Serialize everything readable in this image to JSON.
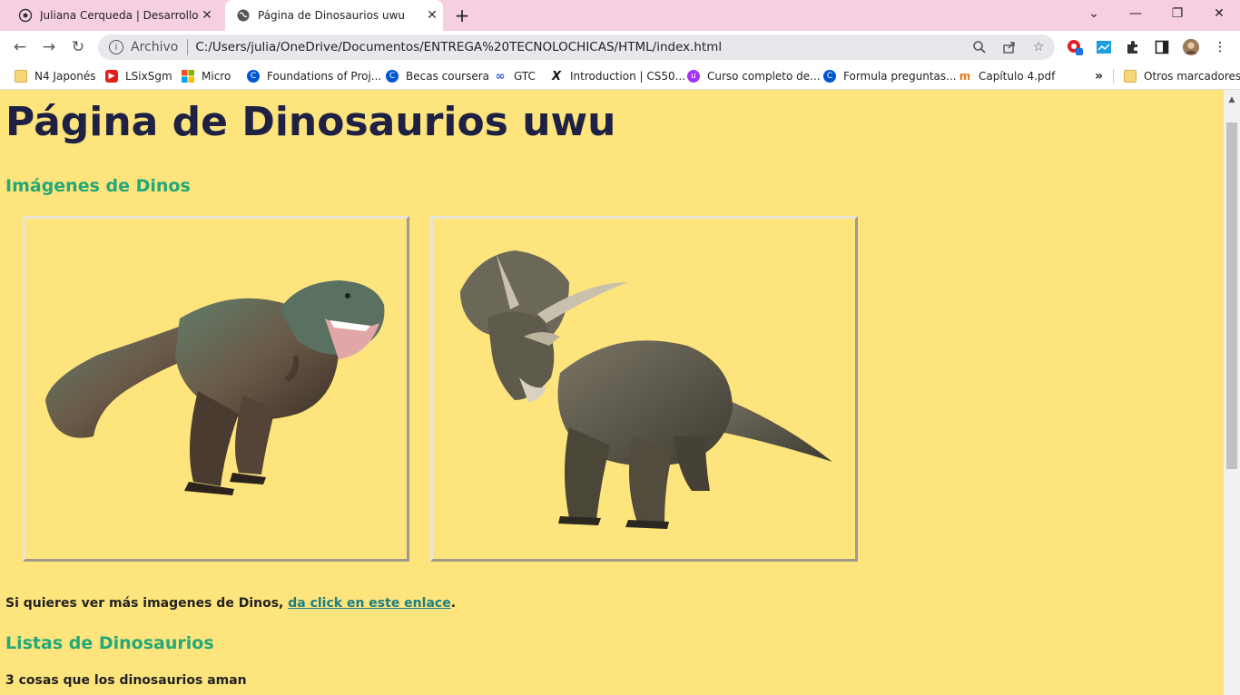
{
  "browser": {
    "tabs": [
      {
        "title": "Juliana Cerqueda | Desarrollo We"
      },
      {
        "title": "Página de Dinosaurios uwu"
      }
    ],
    "address": {
      "scheme_label": "Archivo",
      "url": "C:/Users/julia/OneDrive/Documentos/ENTREGA%20TECNOLOCHICAS/HTML/index.html"
    },
    "bookmarks": [
      {
        "label": "N4 Japonés",
        "icon": "folder-icon"
      },
      {
        "label": "LSixSgm",
        "icon": "youtube-icon"
      },
      {
        "label": "Micro",
        "icon": "microsoft-icon"
      },
      {
        "label": "Foundations of Proj...",
        "icon": "coursera-icon"
      },
      {
        "label": "Becas coursera",
        "icon": "coursera-icon"
      },
      {
        "label": "GTC",
        "icon": "infinity-icon"
      },
      {
        "label": "Introduction | CS50...",
        "icon": "x-icon"
      },
      {
        "label": "Curso completo de...",
        "icon": "udemy-icon"
      },
      {
        "label": "Formula preguntas...",
        "icon": "coursera-icon"
      },
      {
        "label": "Capítulo 4.pdf",
        "icon": "cap-icon"
      }
    ],
    "overflow_label": "»",
    "other_bookmarks": "Otros marcadores"
  },
  "page": {
    "title": "Página de Dinosaurios uwu",
    "images_heading": "Imágenes de Dinos",
    "more_text": "Si quieres ver más imagenes de Dinos, ",
    "more_link": "da click en este enlace",
    "more_end": ".",
    "lists_heading": "Listas de Dinosaurios",
    "list_intro": "3 cosas que los dinosaurios ",
    "list_intro_bold": "aman"
  }
}
